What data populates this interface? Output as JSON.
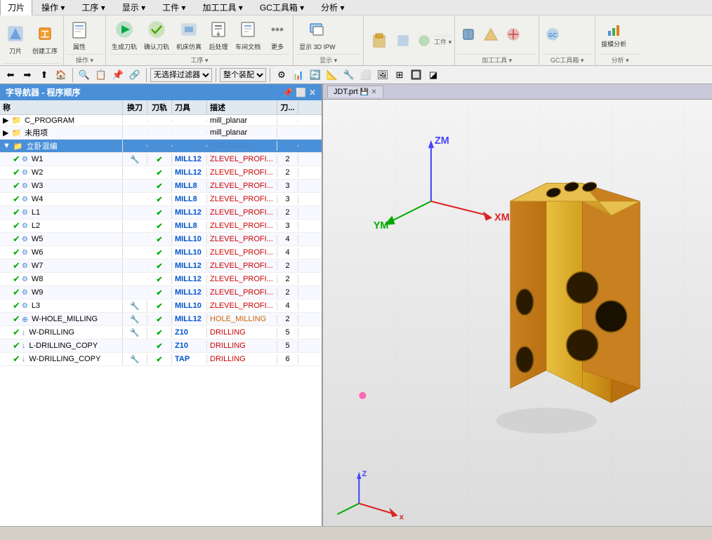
{
  "app": {
    "title": "字导航器 - 程序顺序"
  },
  "tabs": {
    "刀片": "刀片",
    "操作": "操作 ▾",
    "工序": "工序 ▾",
    "显示": "显示 ▾",
    "工件": "工件 ▾",
    "加工工具": "加工工具 ▾",
    "GC工具箱": "GC工具箱 ▾",
    "分析": "分析 ▾"
  },
  "toolbar": {
    "filter_label": "无选择过滤器",
    "assembly_label": "整个装配"
  },
  "tree": {
    "title": "字导航器 - 程序顺序",
    "columns": {
      "name": "称",
      "tool_change": "换刀",
      "tool_path": "刀轨",
      "tool": "刀具",
      "desc": "描述",
      "num": "刀..."
    },
    "rows": [
      {
        "indent": 1,
        "name": "C_PROGRAM",
        "tool_change": "",
        "tool_path": "",
        "tool": "",
        "desc": "mill_planar",
        "num": "",
        "selected": false,
        "type": "folder"
      },
      {
        "indent": 1,
        "name": "未用项",
        "tool_change": "",
        "tool_path": "",
        "tool": "",
        "desc": "mill_planar",
        "num": "",
        "selected": false,
        "type": "folder"
      },
      {
        "indent": 1,
        "name": "立卧混编",
        "tool_change": "",
        "tool_path": "",
        "tool": "",
        "desc": "PROGRAM",
        "num": "",
        "selected": true,
        "type": "folder"
      },
      {
        "indent": 2,
        "name": "W1",
        "tool_change": "icon",
        "tool_path": "✓",
        "tool": "MILL12",
        "desc": "ZLEVEL_PROFI...",
        "num": "2",
        "selected": false,
        "type": "op"
      },
      {
        "indent": 2,
        "name": "W2",
        "tool_change": "",
        "tool_path": "✓",
        "tool": "MILL12",
        "desc": "ZLEVEL_PROFI...",
        "num": "2",
        "selected": false,
        "type": "op"
      },
      {
        "indent": 2,
        "name": "W3",
        "tool_change": "",
        "tool_path": "✓",
        "tool": "MILL8",
        "desc": "ZLEVEL_PROFI...",
        "num": "3",
        "selected": false,
        "type": "op"
      },
      {
        "indent": 2,
        "name": "W4",
        "tool_change": "",
        "tool_path": "✓",
        "tool": "MILL8",
        "desc": "ZLEVEL_PROFI...",
        "num": "3",
        "selected": false,
        "type": "op"
      },
      {
        "indent": 2,
        "name": "L1",
        "tool_change": "",
        "tool_path": "✓",
        "tool": "MILL12",
        "desc": "ZLEVEL_PROFI...",
        "num": "2",
        "selected": false,
        "type": "op"
      },
      {
        "indent": 2,
        "name": "L2",
        "tool_change": "",
        "tool_path": "✓",
        "tool": "MILL8",
        "desc": "ZLEVEL_PROFI...",
        "num": "3",
        "selected": false,
        "type": "op"
      },
      {
        "indent": 2,
        "name": "W5",
        "tool_change": "",
        "tool_path": "✓",
        "tool": "MILL10",
        "desc": "ZLEVEL_PROFI...",
        "num": "4",
        "selected": false,
        "type": "op"
      },
      {
        "indent": 2,
        "name": "W6",
        "tool_change": "",
        "tool_path": "✓",
        "tool": "MILL10",
        "desc": "ZLEVEL_PROFI...",
        "num": "4",
        "selected": false,
        "type": "op"
      },
      {
        "indent": 2,
        "name": "W7",
        "tool_change": "",
        "tool_path": "✓",
        "tool": "MILL12",
        "desc": "ZLEVEL_PROFI...",
        "num": "2",
        "selected": false,
        "type": "op"
      },
      {
        "indent": 2,
        "name": "W8",
        "tool_change": "",
        "tool_path": "✓",
        "tool": "MILL12",
        "desc": "ZLEVEL_PROFI...",
        "num": "2",
        "selected": false,
        "type": "op"
      },
      {
        "indent": 2,
        "name": "W9",
        "tool_change": "",
        "tool_path": "✓",
        "tool": "MILL12",
        "desc": "ZLEVEL_PROFI...",
        "num": "2",
        "selected": false,
        "type": "op"
      },
      {
        "indent": 2,
        "name": "L3",
        "tool_change": "icon",
        "tool_path": "✓",
        "tool": "MILL10",
        "desc": "ZLEVEL_PROFI...",
        "num": "4",
        "selected": false,
        "type": "op"
      },
      {
        "indent": 2,
        "name": "W-HOLE_MILLING",
        "tool_change": "icon",
        "tool_path": "✓",
        "tool": "MILL12",
        "desc": "HOLE_MILLING",
        "num": "2",
        "selected": false,
        "type": "op-hole"
      },
      {
        "indent": 2,
        "name": "W-DRILLING",
        "tool_change": "icon",
        "tool_path": "✓",
        "tool": "Z10",
        "desc": "DRILLING",
        "num": "5",
        "selected": false,
        "type": "op-drill"
      },
      {
        "indent": 2,
        "name": "L-DRILLING_COPY",
        "tool_change": "",
        "tool_path": "✓",
        "tool": "Z10",
        "desc": "DRILLING",
        "num": "5",
        "selected": false,
        "type": "op-drill"
      },
      {
        "indent": 2,
        "name": "W-DRILLING_COPY",
        "tool_change": "icon",
        "tool_path": "✓",
        "tool": "TAP",
        "desc": "DRILLING",
        "num": "6",
        "selected": false,
        "type": "op-drill"
      }
    ]
  },
  "viewport": {
    "tab_label": "JDT.prt",
    "axes": {
      "zm": "ZM",
      "ym": "YM",
      "xm": "XM",
      "z": "Z",
      "x": "x"
    }
  },
  "ribbon_groups": [
    {
      "label": "刀片"
    },
    {
      "label": "操作"
    },
    {
      "label": "工序"
    },
    {
      "label": "显示"
    },
    {
      "label": "工件"
    },
    {
      "label": "加工工具"
    },
    {
      "label": "GC工具箱"
    },
    {
      "label": "分析"
    }
  ],
  "icons": {
    "create_geom": "🔷",
    "create_op": "⚙",
    "property": "📋",
    "gen_toolpath": "▶",
    "verify_toolpath": "✔",
    "machine_sim": "🖥",
    "postprocess": "📤",
    "shopfloor": "📄",
    "more": "⋯",
    "display_3dipw": "👁",
    "analyze": "📊",
    "folder": "📁",
    "check": "✔",
    "tool_icon": "🔧"
  },
  "status": ""
}
